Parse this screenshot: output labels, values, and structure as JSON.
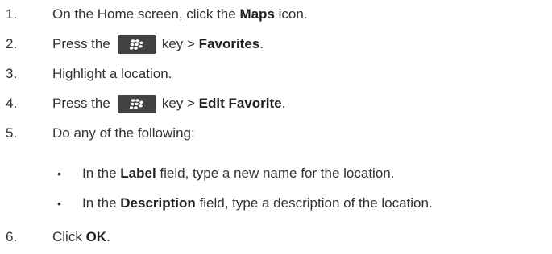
{
  "steps": [
    {
      "num": "1.",
      "pre": "On the Home screen, click the ",
      "bold": "Maps",
      "post": " icon."
    },
    {
      "num": "2.",
      "pre": "Press the",
      "key_icon": "blackberry-menu-key-icon",
      "mid": "key > ",
      "bold": "Favorites",
      "post": "."
    },
    {
      "num": "3.",
      "text": "Highlight a location."
    },
    {
      "num": "4.",
      "pre": "Press the",
      "key_icon": "blackberry-menu-key-icon",
      "mid": "key > ",
      "bold": "Edit Favorite",
      "post": "."
    },
    {
      "num": "5.",
      "text": "Do any of the following:"
    },
    {
      "num": "6.",
      "pre": "Click ",
      "bold": "OK",
      "post": "."
    }
  ],
  "substeps": [
    {
      "bullet": "•",
      "pre": "In the ",
      "bold": "Label",
      "post": " field, type a new name for the location."
    },
    {
      "bullet": "•",
      "pre": "In the ",
      "bold": "Description",
      "post": " field, type a description of the location."
    }
  ]
}
